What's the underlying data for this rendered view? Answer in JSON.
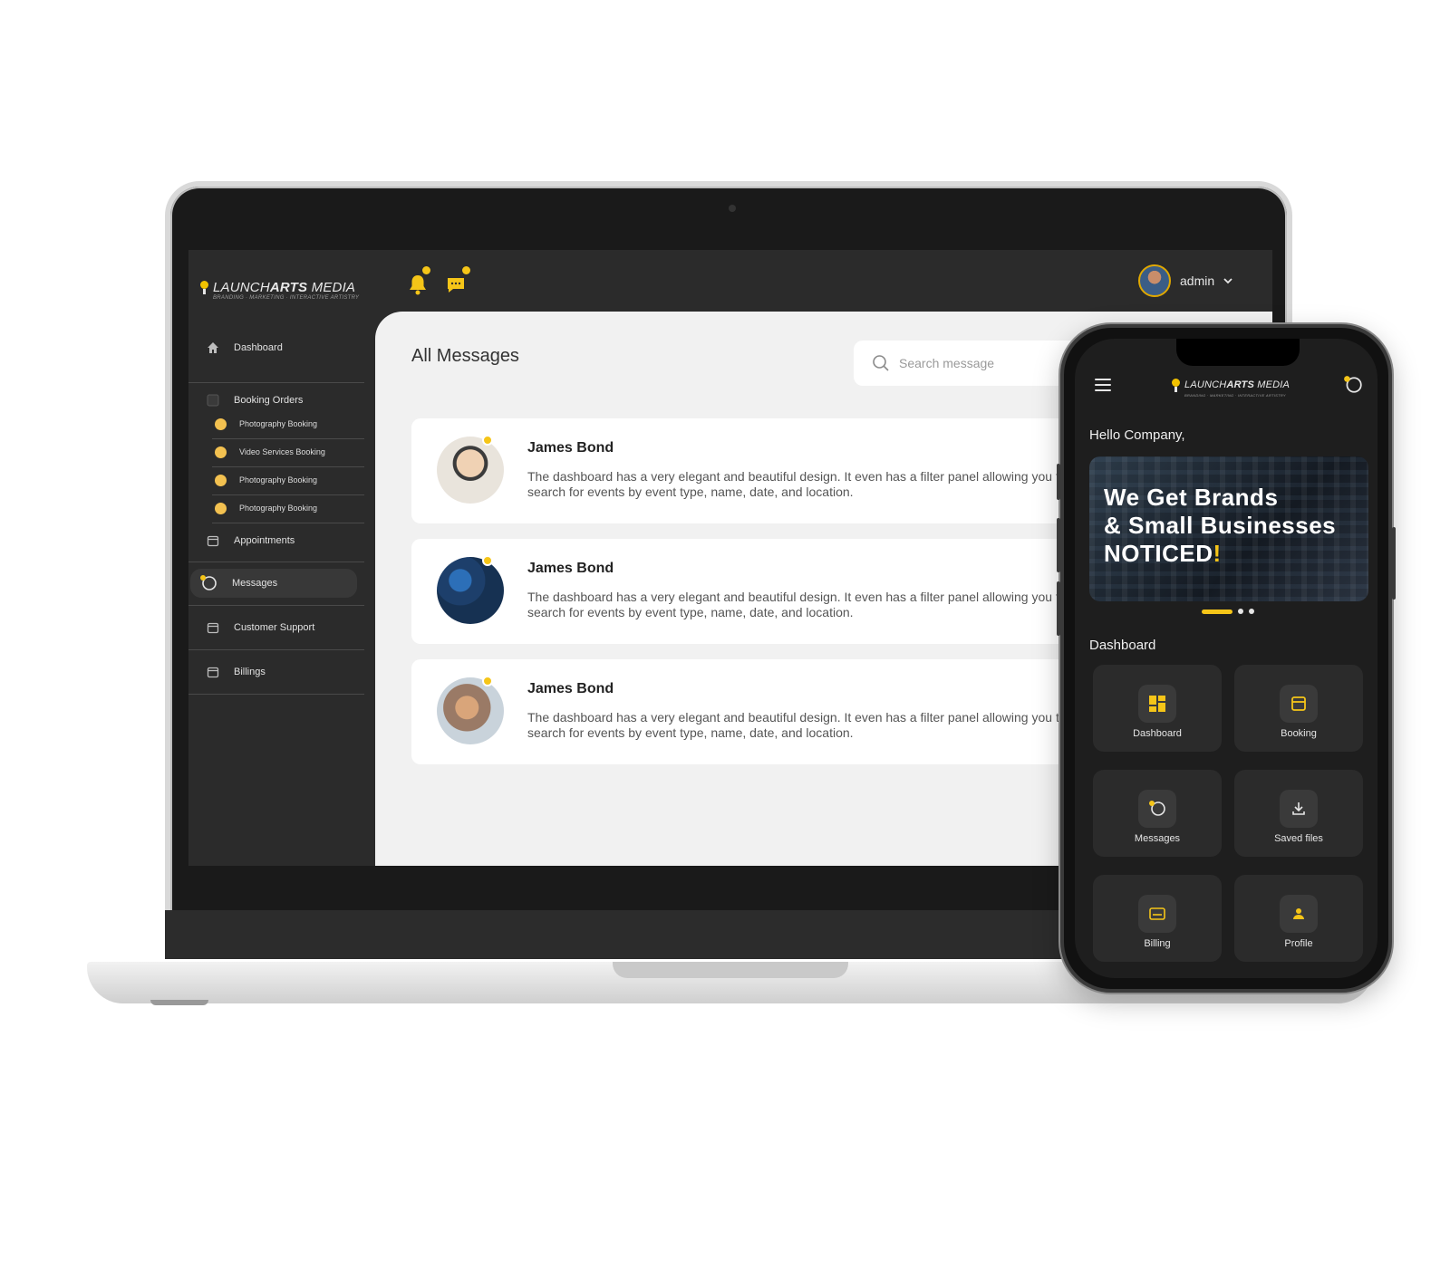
{
  "brand": {
    "name_light": "LAUNCH",
    "name_bold": "ARTS",
    "name_rest": " MEDIA",
    "tagline": "BRANDING · MARKETING · INTERACTIVE ARTISTRY"
  },
  "topbar": {
    "user": "admin"
  },
  "sidebar": {
    "dashboard": "Dashboard",
    "booking_orders": "Booking Orders",
    "sub_items": [
      "Photography Booking",
      "Video Services Booking",
      "Photography Booking",
      "Photography Booking"
    ],
    "appointments": "Appointments",
    "messages": "Messages",
    "customer_support": "Customer Support",
    "billings": "Billings"
  },
  "main": {
    "title": "All Messages",
    "search_placeholder": "Search message",
    "messages": [
      {
        "name": "James Bond",
        "text": "The dashboard has a very elegant and beautiful design. It even has a filter panel allowing you to search for events by event type, name, date, and location."
      },
      {
        "name": "James Bond",
        "text": "The dashboard has a very elegant and beautiful design. It even has a filter panel allowing you to search for events by event type, name, date, and location."
      },
      {
        "name": "James Bond",
        "text": "The dashboard has a very elegant and beautiful design. It even has a filter panel allowing you to search for events by event type, name, date, and location."
      }
    ]
  },
  "phone": {
    "greeting": "Hello Company,",
    "banner": {
      "line1": "We Get Brands",
      "line2": "& Small Businesses",
      "line3": "NOTICED",
      "excl": "!"
    },
    "section": "Dashboard",
    "tiles": [
      "Dashboard",
      "Booking",
      "Messages",
      "Saved files",
      "Billing",
      "Profile"
    ]
  },
  "colors": {
    "accent": "#f5c518",
    "dark": "#2b2b2b",
    "panel": "#f1f1f1"
  }
}
